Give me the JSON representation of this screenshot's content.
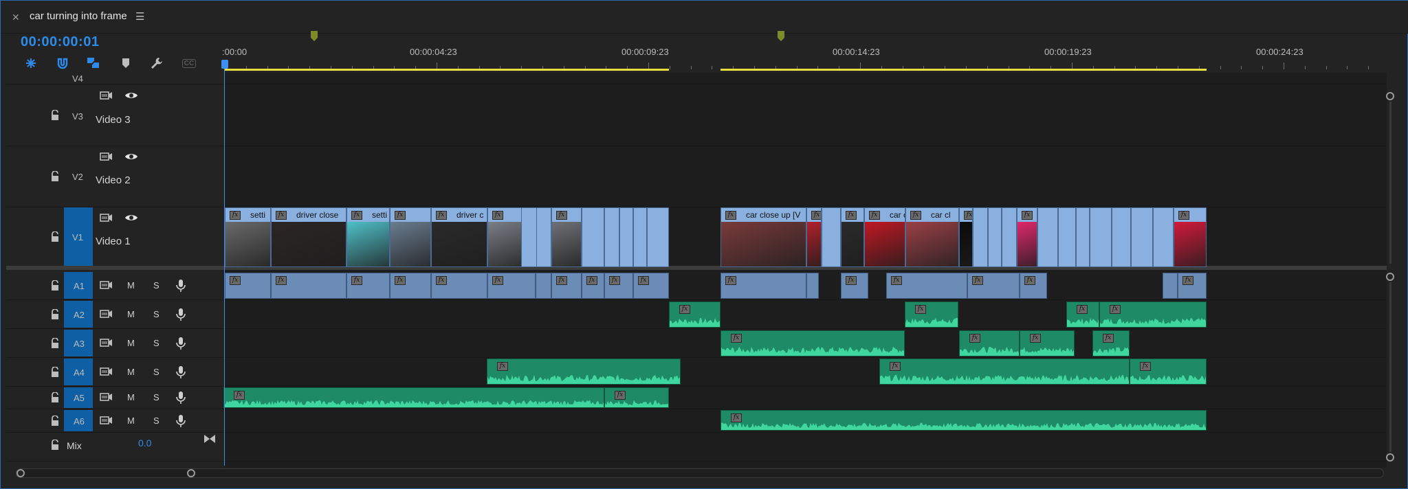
{
  "tab": {
    "title": "car turning into frame",
    "close_icon": "close-icon",
    "menu_icon": "hamburger-menu-icon"
  },
  "timecode": "00:00:00:01",
  "toolbar": [
    {
      "name": "snap-icon"
    },
    {
      "name": "magnet-icon"
    },
    {
      "name": "linked-selection-icon"
    },
    {
      "name": "add-marker-icon"
    },
    {
      "name": "wrench-icon"
    },
    {
      "name": "captions-icon",
      "label": "CC"
    }
  ],
  "ruler": {
    "labels": [
      ":00:00",
      "00:00:04:23",
      "00:00:09:23",
      "00:00:14:23",
      "00:00:19:23",
      "00:00:24:23"
    ]
  },
  "video_tracks": [
    {
      "id": "V4",
      "name": ""
    },
    {
      "id": "V3",
      "name": "Video 3"
    },
    {
      "id": "V2",
      "name": "Video 2"
    },
    {
      "id": "V1",
      "name": "Video 1"
    }
  ],
  "audio_tracks": [
    {
      "id": "A1",
      "m": "M",
      "s": "S"
    },
    {
      "id": "A2",
      "m": "M",
      "s": "S"
    },
    {
      "id": "A3",
      "m": "M",
      "s": "S"
    },
    {
      "id": "A4",
      "m": "M",
      "s": "S"
    },
    {
      "id": "A5",
      "m": "M",
      "s": "S"
    },
    {
      "id": "A6",
      "m": "M",
      "s": "S"
    }
  ],
  "mix": {
    "label": "Mix",
    "value": "0.0"
  },
  "v1_clips": [
    {
      "label": "setti"
    },
    {
      "label": "driver close"
    },
    {
      "label": "setti"
    },
    {
      "label": ""
    },
    {
      "label": "driver c"
    },
    {
      "label": ""
    },
    {
      "label": ""
    },
    {
      "label": "car close up [V"
    },
    {
      "label": "car c"
    },
    {
      "label": "car close"
    },
    {
      "label": "car cl"
    },
    {
      "label": ""
    },
    {
      "label": ""
    }
  ],
  "colors": {
    "accent": "#2d8ceb",
    "video_clip": "#8ab0e0",
    "audio_clip": "#1f8a66",
    "work_area": "#e7dd3c",
    "marker": "#7c8a2a"
  }
}
